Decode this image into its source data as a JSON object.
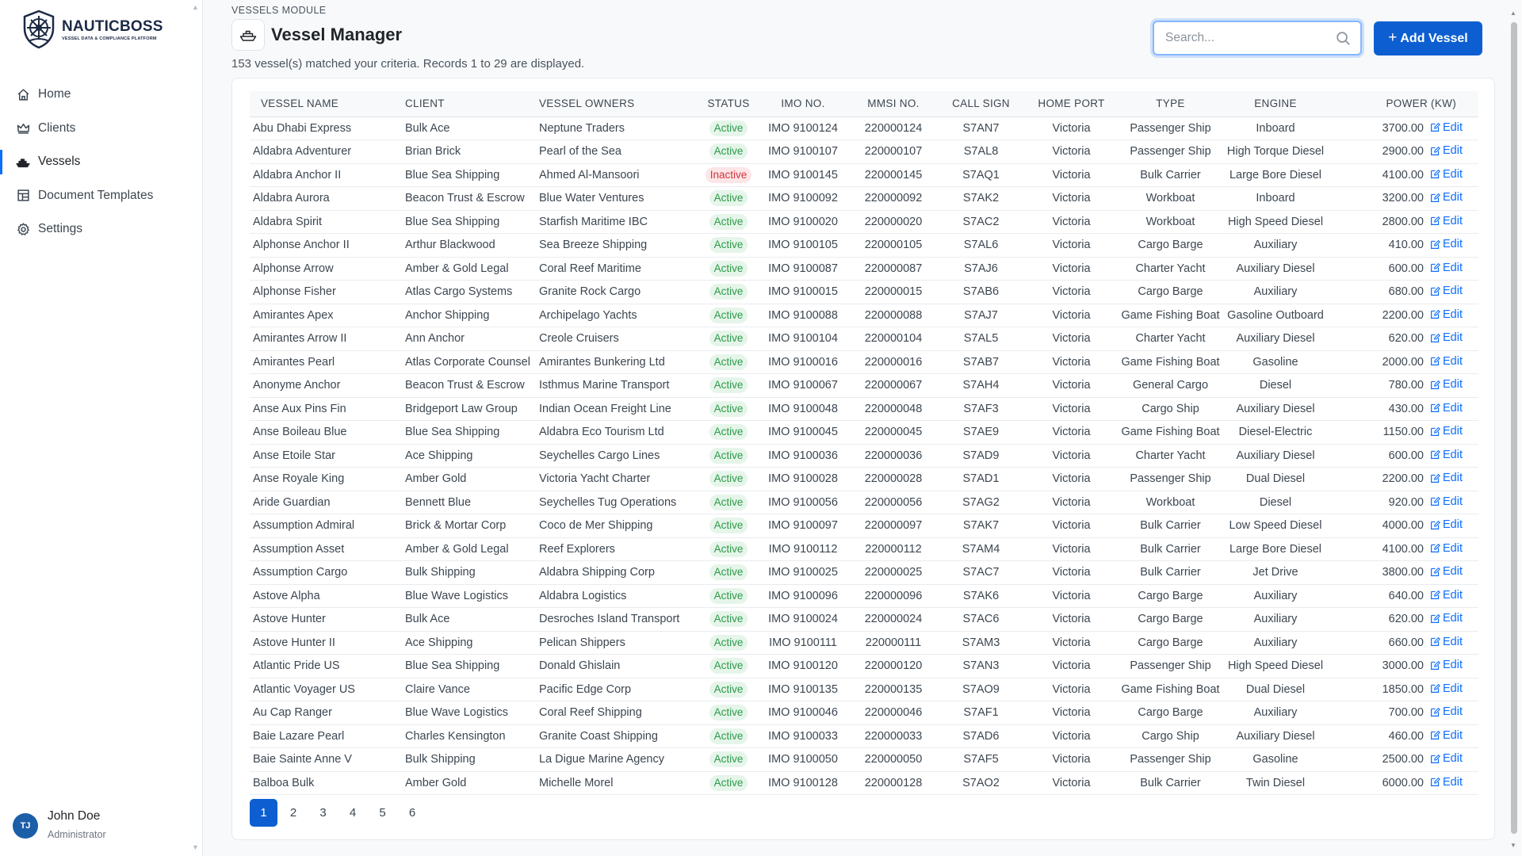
{
  "brand": {
    "name": "NAUTICBOSS",
    "tagline": "VESSEL DATA & COMPLIANCE PLATFORM"
  },
  "nav": [
    {
      "label": "Home",
      "icon": "home-icon"
    },
    {
      "label": "Clients",
      "icon": "crown-icon"
    },
    {
      "label": "Vessels",
      "icon": "ship-icon",
      "active": true
    },
    {
      "label": "Document Templates",
      "icon": "templates-icon"
    },
    {
      "label": "Settings",
      "icon": "gear-icon"
    }
  ],
  "user": {
    "initials": "TJ",
    "name": "John Doe",
    "role": "Administrator"
  },
  "header": {
    "module": "VESSELS MODULE",
    "title": "Vessel Manager",
    "summary": "153 vessel(s) matched your criteria. Records 1 to 29  are displayed."
  },
  "search": {
    "placeholder": "Search...",
    "value": ""
  },
  "add_button": {
    "label": "Add Vessel"
  },
  "columns": [
    "VESSEL NAME",
    "CLIENT",
    "VESSEL OWNERS",
    "STATUS",
    "IMO NO.",
    "MMSI NO.",
    "CALL SIGN",
    "HOME PORT",
    "TYPE",
    "ENGINE",
    "POWER (KW)"
  ],
  "edit_label": "Edit",
  "rows": [
    [
      "Abu Dhabi Express",
      "Bulk Ace",
      "Neptune Traders",
      "Active",
      "IMO 9100124",
      "220000124",
      "S7AN7",
      "Victoria",
      "Passenger Ship",
      "Inboard",
      "3700.00"
    ],
    [
      "Aldabra Adventurer",
      "Brian Brick",
      "Pearl of the Sea",
      "Active",
      "IMO 9100107",
      "220000107",
      "S7AL8",
      "Victoria",
      "Passenger Ship",
      "High Torque Diesel",
      "2900.00"
    ],
    [
      "Aldabra Anchor II",
      "Blue Sea Shipping",
      "Ahmed Al-Mansoori",
      "Inactive",
      "IMO 9100145",
      "220000145",
      "S7AQ1",
      "Victoria",
      "Bulk Carrier",
      "Large Bore Diesel",
      "4100.00"
    ],
    [
      "Aldabra Aurora",
      "Beacon Trust & Escrow",
      "Blue Water Ventures",
      "Active",
      "IMO 9100092",
      "220000092",
      "S7AK2",
      "Victoria",
      "Workboat",
      "Inboard",
      "3200.00"
    ],
    [
      "Aldabra Spirit",
      "Blue Sea Shipping",
      "Starfish Maritime IBC",
      "Active",
      "IMO 9100020",
      "220000020",
      "S7AC2",
      "Victoria",
      "Workboat",
      "High Speed Diesel",
      "2800.00"
    ],
    [
      "Alphonse Anchor II",
      "Arthur Blackwood",
      "Sea Breeze Shipping",
      "Active",
      "IMO 9100105",
      "220000105",
      "S7AL6",
      "Victoria",
      "Cargo Barge",
      "Auxiliary",
      "410.00"
    ],
    [
      "Alphonse Arrow",
      "Amber & Gold Legal",
      "Coral Reef Maritime",
      "Active",
      "IMO 9100087",
      "220000087",
      "S7AJ6",
      "Victoria",
      "Charter Yacht",
      "Auxiliary Diesel",
      "600.00"
    ],
    [
      "Alphonse Fisher",
      "Atlas Cargo Systems",
      "Granite Rock Cargo",
      "Active",
      "IMO 9100015",
      "220000015",
      "S7AB6",
      "Victoria",
      "Cargo Barge",
      "Auxiliary",
      "680.00"
    ],
    [
      "Amirantes Apex",
      "Anchor Shipping",
      "Archipelago Yachts",
      "Active",
      "IMO 9100088",
      "220000088",
      "S7AJ7",
      "Victoria",
      "Game Fishing Boat",
      "Gasoline Outboard",
      "2200.00"
    ],
    [
      "Amirantes Arrow II",
      "Ann Anchor",
      "Creole Cruisers",
      "Active",
      "IMO 9100104",
      "220000104",
      "S7AL5",
      "Victoria",
      "Charter Yacht",
      "Auxiliary Diesel",
      "620.00"
    ],
    [
      "Amirantes Pearl",
      "Atlas Corporate Counsel",
      "Amirantes Bunkering Ltd",
      "Active",
      "IMO 9100016",
      "220000016",
      "S7AB7",
      "Victoria",
      "Game Fishing Boat",
      "Gasoline",
      "2000.00"
    ],
    [
      "Anonyme Anchor",
      "Beacon Trust & Escrow",
      "Isthmus Marine Transport",
      "Active",
      "IMO 9100067",
      "220000067",
      "S7AH4",
      "Victoria",
      "General Cargo",
      "Diesel",
      "780.00"
    ],
    [
      "Anse Aux Pins Fin",
      "Bridgeport Law Group",
      "Indian Ocean Freight Line",
      "Active",
      "IMO 9100048",
      "220000048",
      "S7AF3",
      "Victoria",
      "Cargo Ship",
      "Auxiliary Diesel",
      "430.00"
    ],
    [
      "Anse Boileau Blue",
      "Blue Sea Shipping",
      "Aldabra Eco Tourism Ltd",
      "Active",
      "IMO 9100045",
      "220000045",
      "S7AE9",
      "Victoria",
      "Game Fishing Boat",
      "Diesel-Electric",
      "1150.00"
    ],
    [
      "Anse Etoile Star",
      "Ace Shipping",
      "Seychelles Cargo Lines",
      "Active",
      "IMO 9100036",
      "220000036",
      "S7AD9",
      "Victoria",
      "Charter Yacht",
      "Auxiliary Diesel",
      "600.00"
    ],
    [
      "Anse Royale King",
      "Amber Gold",
      "Victoria Yacht Charter",
      "Active",
      "IMO 9100028",
      "220000028",
      "S7AD1",
      "Victoria",
      "Passenger Ship",
      "Dual Diesel",
      "2200.00"
    ],
    [
      "Aride Guardian",
      "Bennett Blue",
      "Seychelles Tug Operations",
      "Active",
      "IMO 9100056",
      "220000056",
      "S7AG2",
      "Victoria",
      "Workboat",
      "Diesel",
      "920.00"
    ],
    [
      "Assumption Admiral",
      "Brick & Mortar Corp",
      "Coco de Mer Shipping",
      "Active",
      "IMO 9100097",
      "220000097",
      "S7AK7",
      "Victoria",
      "Bulk Carrier",
      "Low Speed Diesel",
      "4000.00"
    ],
    [
      "Assumption Asset",
      "Amber & Gold Legal",
      "Reef Explorers",
      "Active",
      "IMO 9100112",
      "220000112",
      "S7AM4",
      "Victoria",
      "Bulk Carrier",
      "Large Bore Diesel",
      "4100.00"
    ],
    [
      "Assumption Cargo",
      "Bulk Shipping",
      "Aldabra Shipping Corp",
      "Active",
      "IMO 9100025",
      "220000025",
      "S7AC7",
      "Victoria",
      "Bulk Carrier",
      "Jet Drive",
      "3800.00"
    ],
    [
      "Astove Alpha",
      "Blue Wave Logistics",
      "Aldabra Logistics",
      "Active",
      "IMO 9100096",
      "220000096",
      "S7AK6",
      "Victoria",
      "Cargo Barge",
      "Auxiliary",
      "640.00"
    ],
    [
      "Astove Hunter",
      "Bulk Ace",
      "Desroches Island Transport",
      "Active",
      "IMO 9100024",
      "220000024",
      "S7AC6",
      "Victoria",
      "Cargo Barge",
      "Auxiliary",
      "620.00"
    ],
    [
      "Astove Hunter II",
      "Ace Shipping",
      "Pelican Shippers",
      "Active",
      "IMO 9100111",
      "220000111",
      "S7AM3",
      "Victoria",
      "Cargo Barge",
      "Auxiliary",
      "660.00"
    ],
    [
      "Atlantic Pride US",
      "Blue Sea Shipping",
      "Donald Ghislain",
      "Active",
      "IMO 9100120",
      "220000120",
      "S7AN3",
      "Victoria",
      "Passenger Ship",
      "High Speed Diesel",
      "3000.00"
    ],
    [
      "Atlantic Voyager US",
      "Claire Vance",
      "Pacific Edge Corp",
      "Active",
      "IMO 9100135",
      "220000135",
      "S7AO9",
      "Victoria",
      "Game Fishing Boat",
      "Dual Diesel",
      "1850.00"
    ],
    [
      "Au Cap Ranger",
      "Blue Wave Logistics",
      "Coral Reef Shipping",
      "Active",
      "IMO 9100046",
      "220000046",
      "S7AF1",
      "Victoria",
      "Cargo Barge",
      "Auxiliary",
      "700.00"
    ],
    [
      "Baie Lazare Pearl",
      "Charles Kensington",
      "Granite Coast Shipping",
      "Active",
      "IMO 9100033",
      "220000033",
      "S7AD6",
      "Victoria",
      "Cargo Ship",
      "Auxiliary Diesel",
      "460.00"
    ],
    [
      "Baie Sainte Anne V",
      "Bulk Shipping",
      "La Digue Marine Agency",
      "Active",
      "IMO 9100050",
      "220000050",
      "S7AF5",
      "Victoria",
      "Passenger Ship",
      "Gasoline",
      "2500.00"
    ],
    [
      "Balboa Bulk",
      "Amber Gold",
      "Michelle Morel",
      "Active",
      "IMO 9100128",
      "220000128",
      "S7AO2",
      "Victoria",
      "Bulk Carrier",
      "Twin Diesel",
      "6000.00"
    ]
  ],
  "pagination": {
    "pages": [
      "1",
      "2",
      "3",
      "4",
      "5",
      "6"
    ],
    "current": "1"
  },
  "colors": {
    "accent": "#0d5fd1",
    "active_bg": "#e6f5ea",
    "active_fg": "#2d9a4a",
    "inactive_bg": "#fde6e7",
    "inactive_fg": "#d1343e"
  }
}
